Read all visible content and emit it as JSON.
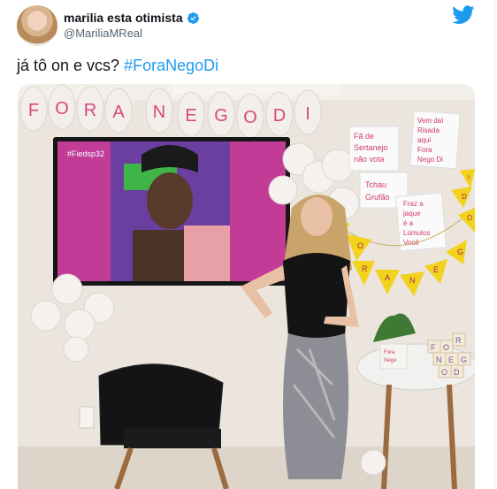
{
  "user": {
    "display_name": "marilia esta otimista",
    "handle": "@MariliaMReal"
  },
  "tweet": {
    "text": "já tô on e vcs?",
    "hashtag": "#ForaNegoDi"
  },
  "photo": {
    "balloon_letters": [
      "F",
      "O",
      "R",
      "A",
      "N",
      "E",
      "G",
      "O",
      "D",
      "I"
    ],
    "tv_tag": "#Fiedsp32",
    "signs": [
      {
        "lines": [
          "Fã de",
          "Sertanejo",
          "não vota"
        ]
      },
      {
        "lines": [
          "Vem daí",
          "Risada",
          "aqui",
          "Fora",
          "Nego Di"
        ]
      },
      {
        "lines": [
          "Tchau",
          "Grufão"
        ]
      },
      {
        "lines": [
          "Fraz a",
          "jaque",
          "é a",
          "Lúmulos",
          "Você"
        ]
      }
    ],
    "bunting_letters": [
      "F",
      "O",
      "R",
      "A",
      "N",
      "E",
      "G",
      "O",
      "D",
      "I"
    ],
    "box_sign": [
      "Fora",
      "Nego"
    ],
    "block_letters": [
      "F",
      "O",
      "R",
      "N",
      "E",
      "G",
      "O",
      "D"
    ]
  },
  "colors": {
    "brand": "#1d9bf0",
    "hashtag": "#1d9bf0",
    "text": "#0f1419",
    "muted": "#536471",
    "bunting": "#f2d21b"
  },
  "icons": {
    "verified": "verified-badge-icon",
    "logo": "twitter-bird-icon"
  }
}
